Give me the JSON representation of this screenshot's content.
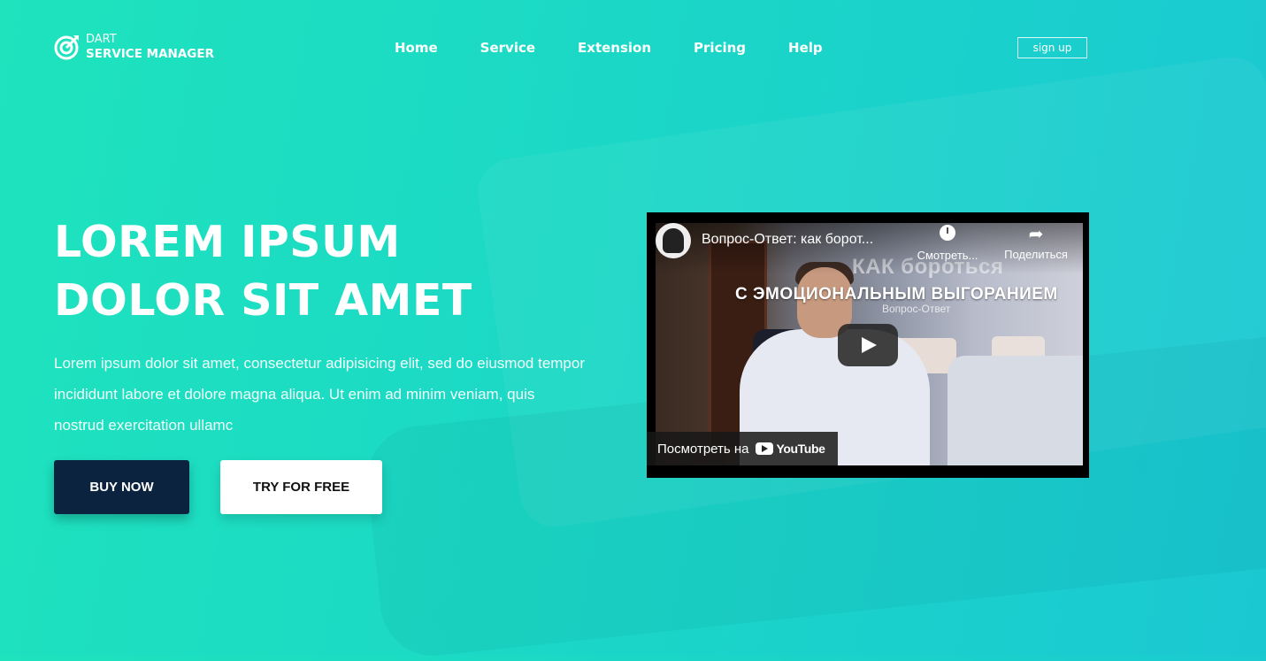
{
  "brand": {
    "line1": "DART",
    "line2": "SERVICE MANAGER"
  },
  "nav": [
    {
      "label": "Home"
    },
    {
      "label": "Service"
    },
    {
      "label": "Extension"
    },
    {
      "label": "Pricing"
    },
    {
      "label": "Help"
    }
  ],
  "header": {
    "signup_label": "sign up"
  },
  "hero": {
    "headline_line1": "LOREM IPSUM",
    "headline_line2": "DOLOR SIT AMET",
    "lead": "Lorem ipsum dolor sit amet, consectetur adipisicing elit, sed do eiusmod tempor incididunt labore et dolore magna aliqua. Ut enim ad minim veniam, quis nostrud exercitation ullamc",
    "buy_label": "BUY NOW",
    "try_label": "TRY FOR FREE"
  },
  "video": {
    "title": "Вопрос-Ответ: как борот...",
    "watch_later_label": "Смотреть...",
    "share_label": "Поделиться",
    "overlay_line1": "КАК бороться",
    "overlay_line2": "С ЭМОЦИОНАЛЬНЫМ ВЫГОРАНИЕМ",
    "overlay_line3": "Вопрос-Ответ",
    "watch_on_label": "Посмотреть на",
    "youtube_label": "YouTube"
  },
  "colors": {
    "gradient_start": "#1ee3bd",
    "gradient_end": "#1ac8d2",
    "buy_button_bg": "#0c2340",
    "try_button_bg": "#ffffff"
  }
}
